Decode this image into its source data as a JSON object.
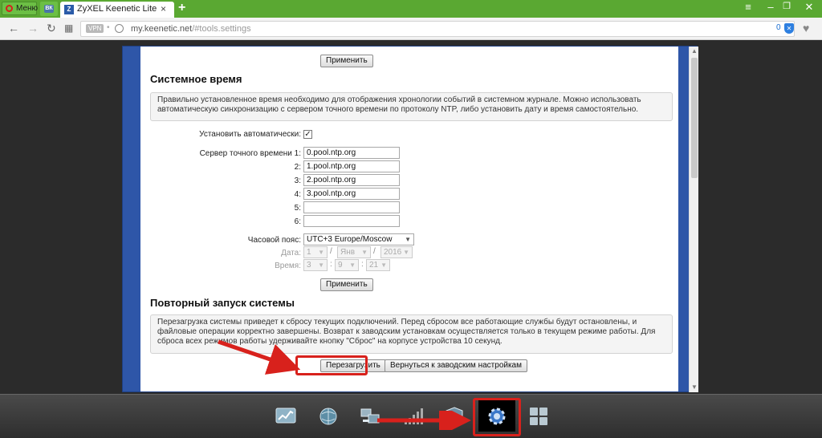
{
  "browser": {
    "menu_label": "Меню",
    "vk_tab_icon": "ВК",
    "tab_title": "ZyXEL Keenetic Lite III Пар",
    "tab_close": "×",
    "new_tab": "+",
    "vpn_label": "VPN",
    "url_host": "my.keenetic.net",
    "url_path": "/#tools.settings",
    "blocked_count": "0"
  },
  "icons": [
    "opera-logo-icon",
    "vk-icon",
    "zyxel-favicon-icon",
    "close-icon",
    "plus-icon",
    "back-icon",
    "forward-icon",
    "reload-icon",
    "grid-icon",
    "globe-icon",
    "shield-icon",
    "heart-icon",
    "monitor-icon",
    "internet-globe-icon",
    "network-icon",
    "wifi-signal-icon",
    "security-shield-icon",
    "gear-icon",
    "apps-icon"
  ],
  "apply_top": "Применить",
  "system_time": {
    "title": "Системное время",
    "info": "Правильно установленное время необходимо для отображения хронологии событий в системном журнале. Можно использовать автоматическую синхронизацию с сервером точного времени по протоколу NTP, либо установить дату и время самостоятельно.",
    "auto_label": "Установить автоматически:",
    "auto_checked": "✓",
    "ntp_label": "Сервер точного времени 1:",
    "servers": [
      {
        "label": "Сервер точного времени 1:",
        "value": "0.pool.ntp.org"
      },
      {
        "label": "2:",
        "value": "1.pool.ntp.org"
      },
      {
        "label": "3:",
        "value": "2.pool.ntp.org"
      },
      {
        "label": "4:",
        "value": "3.pool.ntp.org"
      },
      {
        "label": "5:",
        "value": ""
      },
      {
        "label": "6:",
        "value": ""
      }
    ],
    "tz_label": "Часовой пояс:",
    "tz_value": "UTC+3 Europe/Moscow",
    "date_label": "Дата:",
    "date_day": "1",
    "date_month": "Янв",
    "date_year": "2016",
    "time_label": "Время:",
    "time_h": "3",
    "time_m": "9",
    "time_s": "21",
    "apply": "Применить"
  },
  "restart": {
    "title": "Повторный запуск системы",
    "info": "Перезагрузка системы приведет к сбросу текущих подключений. Перед сбросом все работающие службы будут остановлены, и файловые операции корректно завершены. Возврат к заводским установкам осуществляется только в текущем режиме работы. Для сброса всех режимов работы удерживайте кнопку \"Сброс\" на корпусе устройства 10 секунд.",
    "reboot": "Перезагрузить",
    "factory": "Вернуться к заводским настройкам"
  },
  "colors": {
    "annotation": "#d8211c",
    "tabbar": "#5aa832",
    "frame": "#2e56a8"
  }
}
